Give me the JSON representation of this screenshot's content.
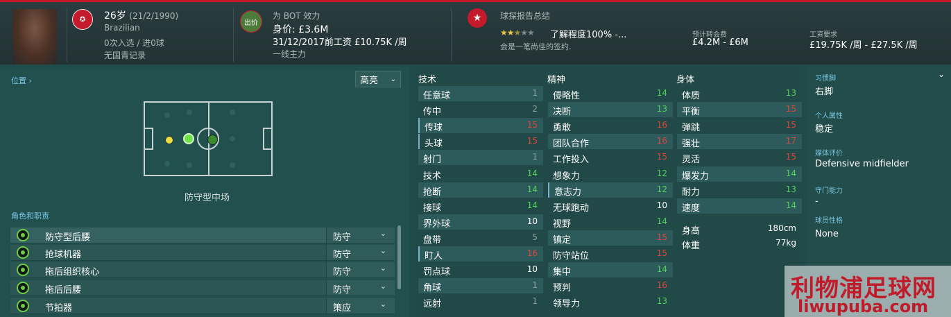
{
  "header": {
    "age": "26岁",
    "dob": "(21/2/1990)",
    "nationality": "Brazilian",
    "caps": "0次入选 / 进0球",
    "youth": "无国青记录",
    "club_badge": "出价",
    "club": "为 BOT 效力",
    "value": "身价: £3.6M",
    "contract": "31/12/2017前工资 £10.75K /周",
    "squad_status": "一线主力",
    "report_title": "球探报告总结",
    "knowledge": "了解程度100% -...",
    "report_text": "会是一笔尚佳的签约.",
    "fee_label": "预计转会费",
    "fee": "£4.2M - £6M",
    "wage_label": "工资要求",
    "wage": "£19.75K /周 - £27.5K /周",
    "stars": {
      "on": "★★",
      "half": "★",
      "off": "★★"
    }
  },
  "left": {
    "position_link": "位置 ›",
    "highlight": "高亮",
    "position_name": "防守型中场",
    "roles_label": "角色和职责",
    "roles": [
      {
        "name": "防守型后腰",
        "duty": "防守"
      },
      {
        "name": "抢球机器",
        "duty": "防守"
      },
      {
        "name": "拖后组织核心",
        "duty": "防守"
      },
      {
        "name": "拖后后腰",
        "duty": "防守"
      },
      {
        "name": "节拍器",
        "duty": "策应"
      }
    ]
  },
  "attrs": {
    "tech_h": "技术",
    "mental_h": "精神",
    "phys_h": "身体",
    "tech": [
      {
        "n": "任意球",
        "v": "1",
        "c": "gray"
      },
      {
        "n": "传中",
        "v": "2",
        "c": "gray"
      },
      {
        "n": "传球",
        "v": "15",
        "c": "red"
      },
      {
        "n": "头球",
        "v": "15",
        "c": "red"
      },
      {
        "n": "射门",
        "v": "1",
        "c": "gray"
      },
      {
        "n": "技术",
        "v": "14",
        "c": "green"
      },
      {
        "n": "抢断",
        "v": "14",
        "c": "green"
      },
      {
        "n": "接球",
        "v": "14",
        "c": "green"
      },
      {
        "n": "界外球",
        "v": "10",
        "c": "white"
      },
      {
        "n": "盘带",
        "v": "5",
        "c": "gray"
      },
      {
        "n": "盯人",
        "v": "16",
        "c": "red"
      },
      {
        "n": "罚点球",
        "v": "10",
        "c": "white"
      },
      {
        "n": "角球",
        "v": "1",
        "c": "gray"
      },
      {
        "n": "远射",
        "v": "1",
        "c": "gray"
      }
    ],
    "mental": [
      {
        "n": "侵略性",
        "v": "14",
        "c": "green"
      },
      {
        "n": "决断",
        "v": "13",
        "c": "green"
      },
      {
        "n": "勇敢",
        "v": "16",
        "c": "red"
      },
      {
        "n": "团队合作",
        "v": "16",
        "c": "red"
      },
      {
        "n": "工作投入",
        "v": "15",
        "c": "red"
      },
      {
        "n": "想象力",
        "v": "12",
        "c": "green"
      },
      {
        "n": "意志力",
        "v": "12",
        "c": "green"
      },
      {
        "n": "无球跑动",
        "v": "10",
        "c": "white"
      },
      {
        "n": "视野",
        "v": "14",
        "c": "green"
      },
      {
        "n": "镇定",
        "v": "15",
        "c": "red"
      },
      {
        "n": "防守站位",
        "v": "15",
        "c": "red"
      },
      {
        "n": "集中",
        "v": "14",
        "c": "green"
      },
      {
        "n": "预判",
        "v": "16",
        "c": "red"
      },
      {
        "n": "领导力",
        "v": "13",
        "c": "green"
      }
    ],
    "phys": [
      {
        "n": "体质",
        "v": "13",
        "c": "green"
      },
      {
        "n": "平衡",
        "v": "15",
        "c": "red"
      },
      {
        "n": "弹跳",
        "v": "15",
        "c": "red"
      },
      {
        "n": "强壮",
        "v": "17",
        "c": "red"
      },
      {
        "n": "灵活",
        "v": "15",
        "c": "red"
      },
      {
        "n": "爆发力",
        "v": "14",
        "c": "green"
      },
      {
        "n": "耐力",
        "v": "13",
        "c": "green"
      },
      {
        "n": "速度",
        "v": "14",
        "c": "green"
      },
      {
        "n": "身高",
        "v": "180cm",
        "c": "white"
      },
      {
        "n": "体重",
        "v": "77kg",
        "c": "white"
      }
    ]
  },
  "right": {
    "foot_label": "习惯脚",
    "foot": "右脚",
    "personality_label": "个人属性",
    "personality": "稳定",
    "media_label": "媒体评价",
    "media": "Defensive midfielder",
    "gk_label": "守门能力",
    "gk": "-",
    "style_label": "球员性格",
    "style": "None"
  },
  "watermark": {
    "cn": "利物浦足球网",
    "url": "liwupuba.com"
  }
}
